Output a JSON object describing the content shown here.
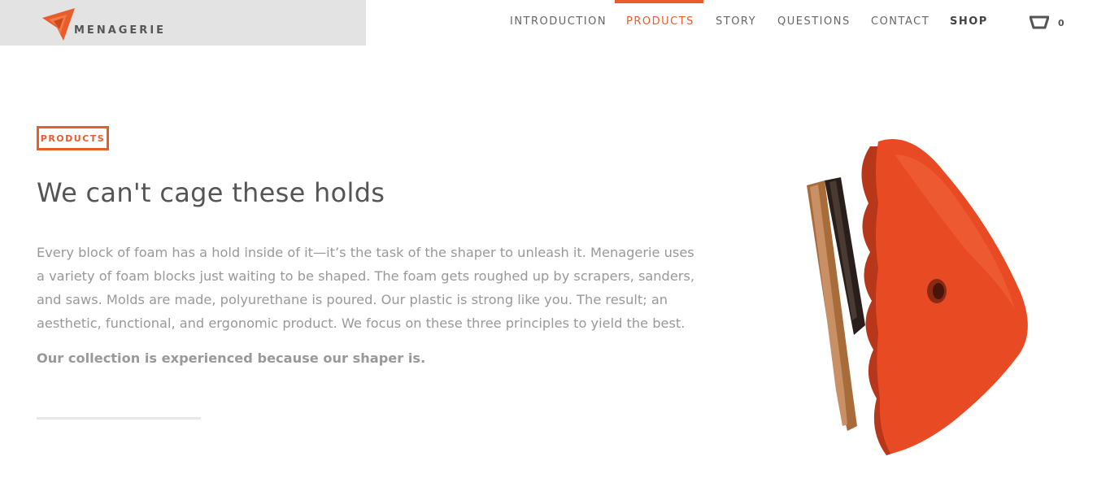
{
  "brand": {
    "name": "MENAGERIE",
    "logo_icon": "menagerie-logo-icon",
    "accent_color": "#e85d2a"
  },
  "nav": {
    "items": [
      {
        "label": "INTRODUCTION",
        "active": false
      },
      {
        "label": "PRODUCTS",
        "active": true
      },
      {
        "label": "STORY",
        "active": false
      },
      {
        "label": "QUESTIONS",
        "active": false
      },
      {
        "label": "CONTACT",
        "active": false
      },
      {
        "label": "SHOP",
        "active": false
      }
    ],
    "cart_icon": "cart-icon",
    "cart_count": "0"
  },
  "section": {
    "badge": "PRODUCTS",
    "headline": "We can't cage these holds",
    "body": "Every block of foam has a hold inside of it—it’s the task of the shaper to unleash it. Menagerie uses a variety of foam blocks just waiting to be shaped. The foam gets roughed up by scrapers, sanders, and saws. Molds are made, polyurethane is poured. Our plastic is strong like you. The result; an aesthetic, functional, and ergonomic product. We focus on these three principles to yield the best.",
    "tagline": "Our collection is experienced because our shaper is."
  },
  "image": {
    "subject": "climbing-hold-with-brush-image"
  }
}
